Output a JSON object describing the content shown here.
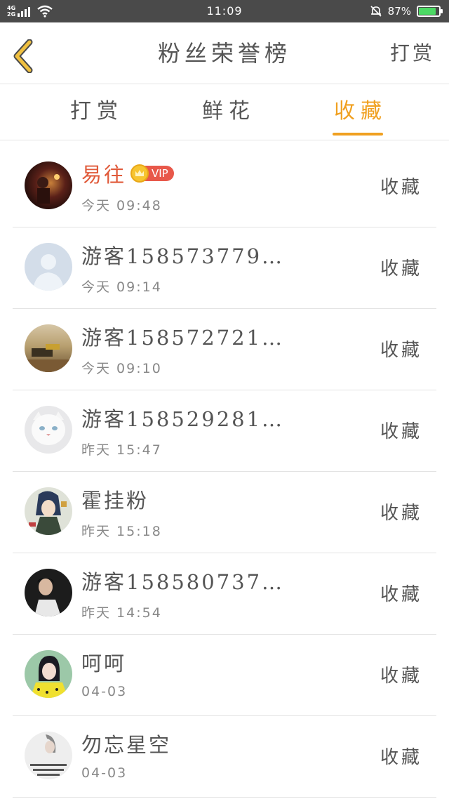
{
  "status_bar": {
    "network_top": "4G",
    "network_bottom": "2G",
    "time": "11:09",
    "battery_text": "87%",
    "battery_level": 0.87,
    "battery_color": "#4cd964",
    "icons": [
      "signal-icon",
      "wifi-icon",
      "mute-bell-icon",
      "battery-icon"
    ]
  },
  "header": {
    "back_icon": "chevron-left-icon",
    "back_icon_color": "#f0c040",
    "title": "粉丝荣誉榜",
    "action": "打赏"
  },
  "tabs": [
    {
      "label": "打赏",
      "active": false
    },
    {
      "label": "鲜花",
      "active": false
    },
    {
      "label": "收藏",
      "active": true
    }
  ],
  "accent_color": "#f0a020",
  "list": [
    {
      "name": "易往",
      "time": "今天 09:48",
      "action": "收藏",
      "vip": true,
      "vip_label": "VIP",
      "avatar": "avatar-photo-dark-red"
    },
    {
      "name": "游客158573779…",
      "time": "今天 09:14",
      "action": "收藏",
      "vip": false,
      "avatar": "default-user-icon"
    },
    {
      "name": "游客158572721…",
      "time": "今天 09:10",
      "action": "收藏",
      "vip": false,
      "avatar": "avatar-photo-desert"
    },
    {
      "name": "游客158529281…",
      "time": "昨天 15:47",
      "action": "收藏",
      "vip": false,
      "avatar": "avatar-photo-white-cat"
    },
    {
      "name": "霍挂粉",
      "time": "昨天 15:18",
      "action": "收藏",
      "vip": false,
      "avatar": "avatar-photo-anime"
    },
    {
      "name": "游客158580737…",
      "time": "昨天 14:54",
      "action": "收藏",
      "vip": false,
      "avatar": "avatar-photo-dark-portrait"
    },
    {
      "name": "呵呵",
      "time": "04-03",
      "action": "收藏",
      "vip": false,
      "avatar": "avatar-photo-girl-yellow"
    },
    {
      "name": "勿忘星空",
      "time": "04-03",
      "action": "收藏",
      "vip": false,
      "avatar": "avatar-photo-calligraphy"
    }
  ]
}
